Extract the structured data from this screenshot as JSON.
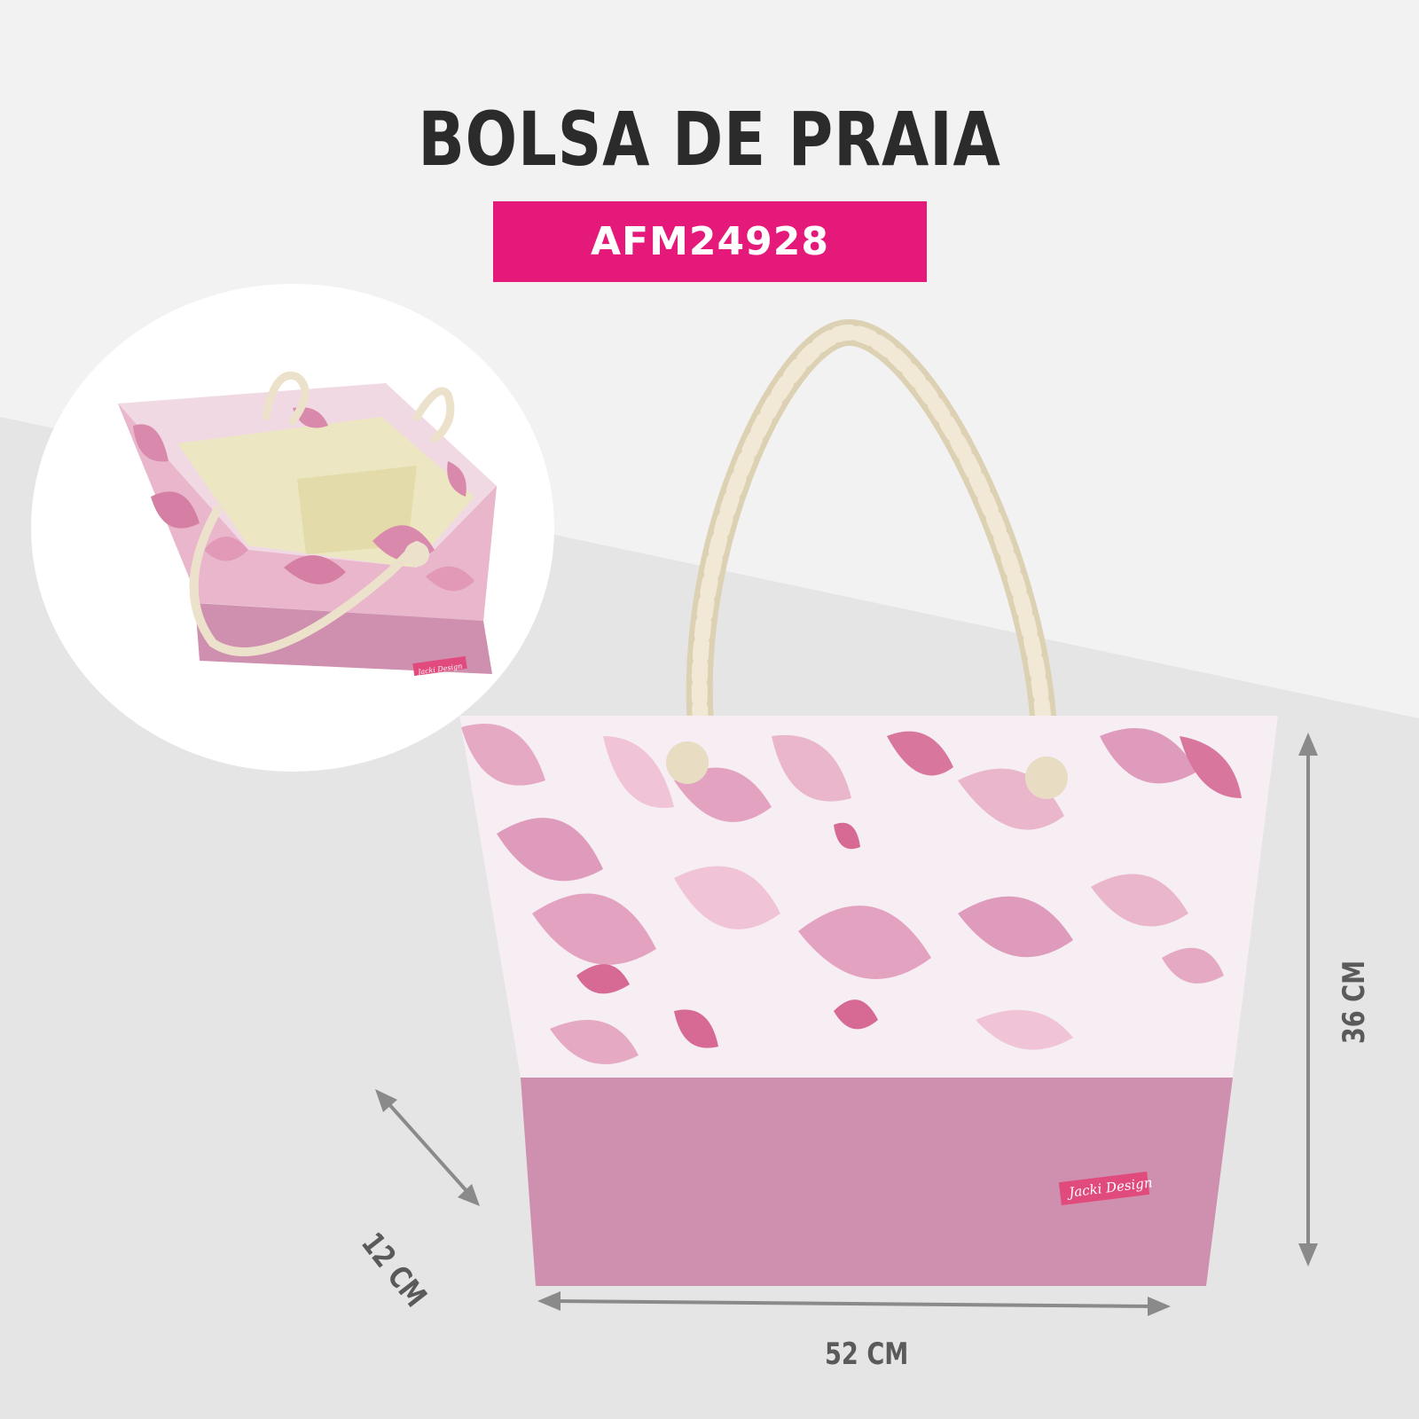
{
  "header": {
    "title": "BOLSA DE PRAIA",
    "product_code": "AFM24928"
  },
  "dimensions": {
    "width": "52 CM",
    "height": "36 CM",
    "depth": "12 CM"
  },
  "product": {
    "brand_label": "Jacki Design"
  },
  "colors": {
    "accent": "#e5197a",
    "text": "#2b2b2b",
    "dimension_text": "#5a5a5a",
    "bag_pink": "#d995b3",
    "bag_base": "#cf8fae",
    "rope": "#ece2cc",
    "lining": "#ece7c2"
  }
}
